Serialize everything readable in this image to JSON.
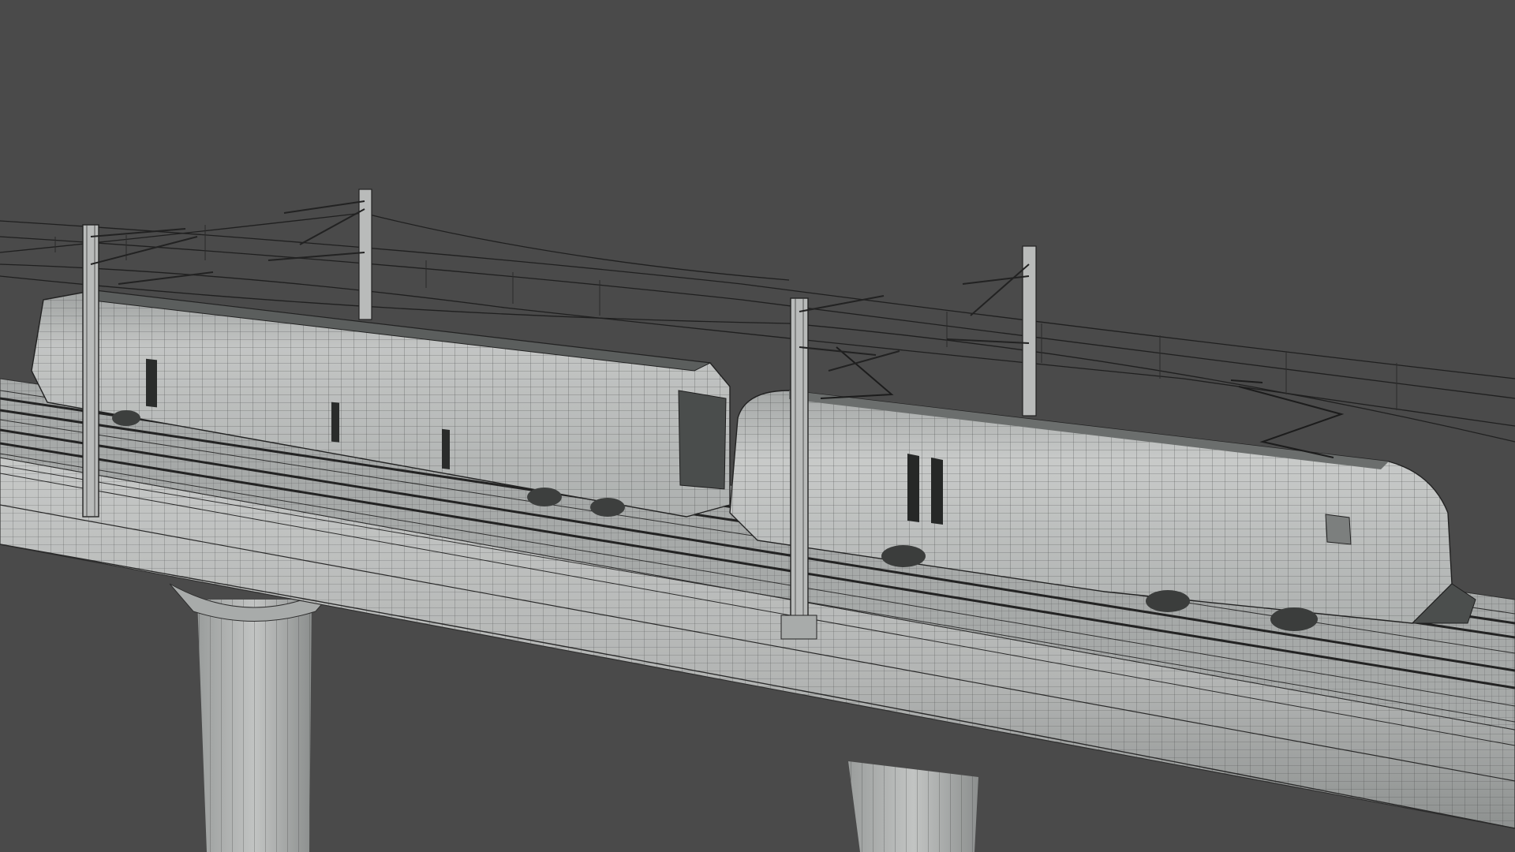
{
  "viewport": {
    "mode": "wireframe-render",
    "background_color": "#4a4a4a",
    "model_fill_color": "#b9bbba",
    "model_shade_color": "#8f9291",
    "wire_color": "#2e2e2e"
  },
  "scene_objects": [
    {
      "name": "viaduct-deck",
      "kind": "bridge"
    },
    {
      "name": "viaduct-pier-left",
      "kind": "pier"
    },
    {
      "name": "viaduct-pier-right",
      "kind": "pier"
    },
    {
      "name": "railway-tracks",
      "kind": "track",
      "count": 2
    },
    {
      "name": "passenger-car",
      "kind": "rail-car"
    },
    {
      "name": "electric-locomotive",
      "kind": "locomotive"
    },
    {
      "name": "catenary-masts",
      "kind": "mast",
      "count": 4
    },
    {
      "name": "overhead-wires",
      "kind": "catenary"
    }
  ]
}
